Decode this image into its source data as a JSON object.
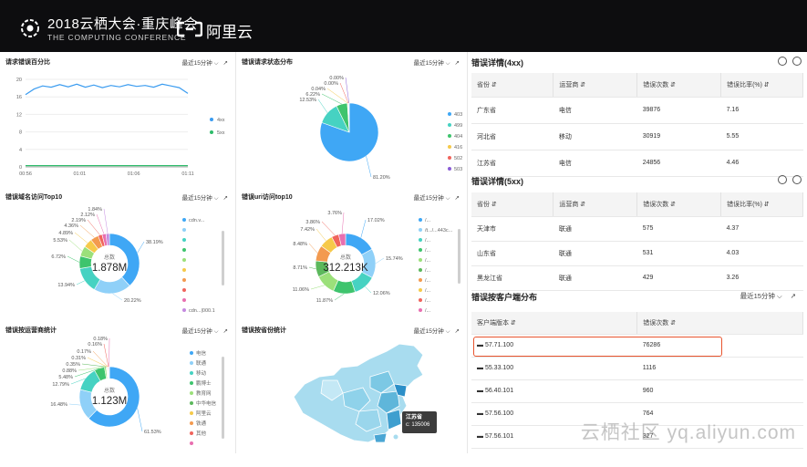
{
  "header": {
    "title": "2018云栖大会·重庆峰会",
    "subtitle": "THE COMPUTING CONFERENCE",
    "brand": "阿里云"
  },
  "panels": {
    "error_rate": {
      "title": "请求错误百分比",
      "range": "最近15分钟"
    },
    "status_dist": {
      "title": "错误请求状态分布",
      "range": "最近15分钟"
    },
    "domain_top": {
      "title": "错误域名访问Top10",
      "range": "最近15分钟"
    },
    "uri_top": {
      "title": "错误uri访问top10",
      "range": "最近15分钟"
    },
    "isp_stat": {
      "title": "错误按运营商统计",
      "range": "最近15分钟"
    },
    "province_stat": {
      "title": "错误按省份统计",
      "range": "最近15分钟"
    }
  },
  "donut_center_label": "总数",
  "domain_total": "1.878M",
  "uri_total": "312.213K",
  "isp_total": "1.123M",
  "chart_data": [
    {
      "type": "line",
      "title": "请求错误百分比",
      "x_ticks": [
        "00:56",
        "01:01",
        "01:06",
        "01:11"
      ],
      "y_ticks": [
        0,
        4,
        8,
        12,
        16,
        20
      ],
      "ylim": [
        0,
        20
      ],
      "legend": "right",
      "series": [
        {
          "name": "4xx",
          "color": "#3b9cf0",
          "values": [
            16.5,
            17.8,
            18.5,
            18.2,
            18.8,
            18.3,
            18.9,
            18.2,
            18.7,
            18.1,
            18.6,
            18.3,
            18.8,
            18.4,
            18.6,
            18.2,
            18.9,
            18.5,
            18.1,
            16.8
          ]
        },
        {
          "name": "5xx",
          "color": "#2dbb6a",
          "values": [
            0.3,
            0.3,
            0.3,
            0.3,
            0.3,
            0.3,
            0.3,
            0.3,
            0.3,
            0.3,
            0.3,
            0.3,
            0.3,
            0.3,
            0.3,
            0.3,
            0.3,
            0.3,
            0.3,
            0.3
          ]
        }
      ]
    },
    {
      "type": "pie",
      "title": "错误请求状态分布",
      "legend": "right",
      "series": [
        {
          "name": "status",
          "values": [
            {
              "label": "403",
              "value": 81.2,
              "text": "81.20%",
              "color": "#3fa7f5"
            },
            {
              "label": "499",
              "value": 12.53,
              "text": "12.53%",
              "color": "#46d2c2"
            },
            {
              "label": "404",
              "value": 6.22,
              "text": "6.22%",
              "color": "#3ec46d"
            },
            {
              "label": "416",
              "value": 0.04,
              "text": "0.04%",
              "color": "#f6c94a"
            },
            {
              "label": "502",
              "value": 0.0,
              "text": "0.00%",
              "color": "#f0645c"
            },
            {
              "label": "503",
              "value": 0.0,
              "text": "0.00%",
              "color": "#8a5cd6"
            }
          ]
        }
      ]
    },
    {
      "type": "pie",
      "title": "错误域名访问Top10",
      "series": [
        {
          "name": "domain",
          "values": [
            {
              "value": 38.19,
              "text": "38.19%",
              "color": "#3fa7f5"
            },
            {
              "value": 20.22,
              "text": "20.22%",
              "color": "#8fd0f8"
            },
            {
              "value": 13.94,
              "text": "13.94%",
              "color": "#46d2c2"
            },
            {
              "value": 6.72,
              "text": "6.72%",
              "color": "#3ec46d"
            },
            {
              "value": 5.53,
              "text": "5.53%",
              "color": "#9be07a"
            },
            {
              "value": 4.89,
              "text": "4.89%",
              "color": "#f6c94a"
            },
            {
              "value": 4.36,
              "text": "4.36%",
              "color": "#f39a4f"
            },
            {
              "value": 2.19,
              "text": "2.19%",
              "color": "#f0645c"
            },
            {
              "value": 2.12,
              "text": "2.12%",
              "color": "#e86fb0"
            },
            {
              "value": 1.84,
              "text": "1.84%",
              "color": "#c48ae0"
            }
          ]
        }
      ],
      "legend_entries": [
        "cdn.v...",
        "",
        "",
        "",
        "",
        "",
        "",
        "",
        "",
        "cdn...|000.1"
      ]
    },
    {
      "type": "pie",
      "title": "错误uri访问top10",
      "series": [
        {
          "name": "uri",
          "values": [
            {
              "value": 17.02,
              "text": "17.02%",
              "color": "#3fa7f5"
            },
            {
              "value": 15.74,
              "text": "15.74%",
              "color": "#8fd0f8"
            },
            {
              "value": 12.06,
              "text": "12.06%",
              "color": "#46d2c2"
            },
            {
              "value": 11.87,
              "text": "11.87%",
              "color": "#3ec46d"
            },
            {
              "value": 11.06,
              "text": "11.06%",
              "color": "#9be07a"
            },
            {
              "value": 8.71,
              "text": "8.71%",
              "color": "#5cb85c"
            },
            {
              "value": 8.48,
              "text": "8.48%",
              "color": "#f39a4f"
            },
            {
              "value": 7.42,
              "text": "7.42%",
              "color": "#f6c94a"
            },
            {
              "value": 3.86,
              "text": "3.86%",
              "color": "#f0645c"
            },
            {
              "value": 3.76,
              "text": "3.76%",
              "color": "#e86fb0"
            }
          ]
        }
      ],
      "legend_entries": [
        "/...",
        "/t.../...443c...",
        "/...",
        "/...",
        "/...",
        "/...",
        "/...",
        "/...",
        "/...",
        "/..."
      ]
    },
    {
      "type": "pie",
      "title": "错误按运营商统计",
      "series": [
        {
          "name": "isp",
          "values": [
            {
              "label": "电信",
              "value": 61.53,
              "text": "61.53%",
              "color": "#3fa7f5"
            },
            {
              "label": "联通",
              "value": 16.48,
              "text": "16.48%",
              "color": "#8fd0f8"
            },
            {
              "label": "移动",
              "value": 12.79,
              "text": "12.79%",
              "color": "#46d2c2"
            },
            {
              "label": "鹏博士",
              "value": 5.48,
              "text": "5.48%",
              "color": "#3ec46d"
            },
            {
              "label": "教育网",
              "value": 0.88,
              "text": "0.88%",
              "color": "#9be07a"
            },
            {
              "label": "中华电信",
              "value": 0.35,
              "text": "0.35%",
              "color": "#5cb85c"
            },
            {
              "label": "阿里云",
              "value": 0.31,
              "text": "0.31%",
              "color": "#f6c94a"
            },
            {
              "label": "铁通",
              "value": 0.17,
              "text": "0.17%",
              "color": "#f39a4f"
            },
            {
              "label": "其他",
              "value": 0.16,
              "text": "0.16%",
              "color": "#f0645c"
            },
            {
              "label": "",
              "value": 0.18,
              "text": "0.18%",
              "color": "#e86fb0"
            }
          ]
        }
      ]
    }
  ],
  "map_tooltip": {
    "province": "江苏省",
    "count": "c: 135006"
  },
  "err4xx": {
    "title": "错误详情(4xx)",
    "columns": [
      "省份",
      "运营商",
      "错误次数",
      "错误比率(%)"
    ],
    "rows": [
      [
        "广东省",
        "电信",
        "39876",
        "7.16"
      ],
      [
        "河北省",
        "移动",
        "30919",
        "5.55"
      ],
      [
        "江苏省",
        "电信",
        "24856",
        "4.46"
      ]
    ]
  },
  "err5xx": {
    "title": "错误详情(5xx)",
    "columns": [
      "省份",
      "运营商",
      "错误次数",
      "错误比率(%)"
    ],
    "rows": [
      [
        "天津市",
        "联通",
        "575",
        "4.37"
      ],
      [
        "山东省",
        "联通",
        "531",
        "4.03"
      ],
      [
        "黑龙江省",
        "联通",
        "429",
        "3.26"
      ]
    ]
  },
  "client_dist": {
    "title": "错误按客户端分布",
    "range": "最近15分钟",
    "columns": [
      "客户端版本",
      "错误次数"
    ],
    "rows": [
      [
        "57.71.100",
        "76286"
      ],
      [
        "55.33.100",
        "1116"
      ],
      [
        "56.40.101",
        "960"
      ],
      [
        "57.56.100",
        "764"
      ],
      [
        "57.56.101",
        "327"
      ]
    ]
  },
  "watermark": "云栖社区 yq.aliyun.com"
}
